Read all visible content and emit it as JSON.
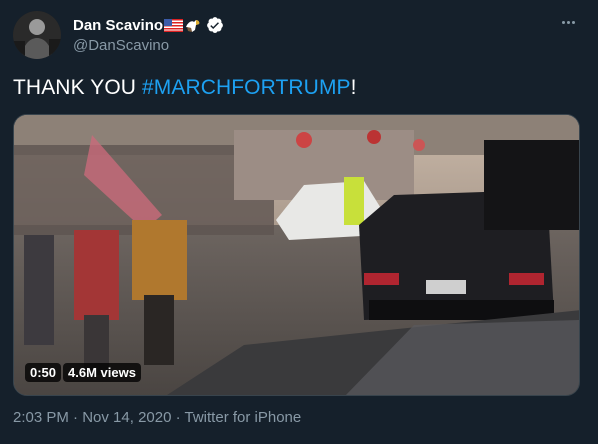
{
  "author": {
    "display_name": "Dan Scavino",
    "handle": "@DanScavino",
    "verified": true,
    "name_emojis": [
      "flag-us-icon",
      "eagle-icon"
    ]
  },
  "tweet": {
    "text_prefix": "THANK YOU ",
    "hashtag": "#MARCHFORTRUMP",
    "text_suffix": "!"
  },
  "media": {
    "type": "video",
    "duration": "0:50",
    "views": "4.6M views"
  },
  "meta": {
    "time": "2:03 PM",
    "sep1": " · ",
    "date": "Nov 14, 2020",
    "sep2": " · ",
    "source": "Twitter for iPhone"
  },
  "colors": {
    "background": "#15202b",
    "link": "#1da1f2",
    "secondary_text": "#8899a6",
    "verified": "#ffffff"
  }
}
